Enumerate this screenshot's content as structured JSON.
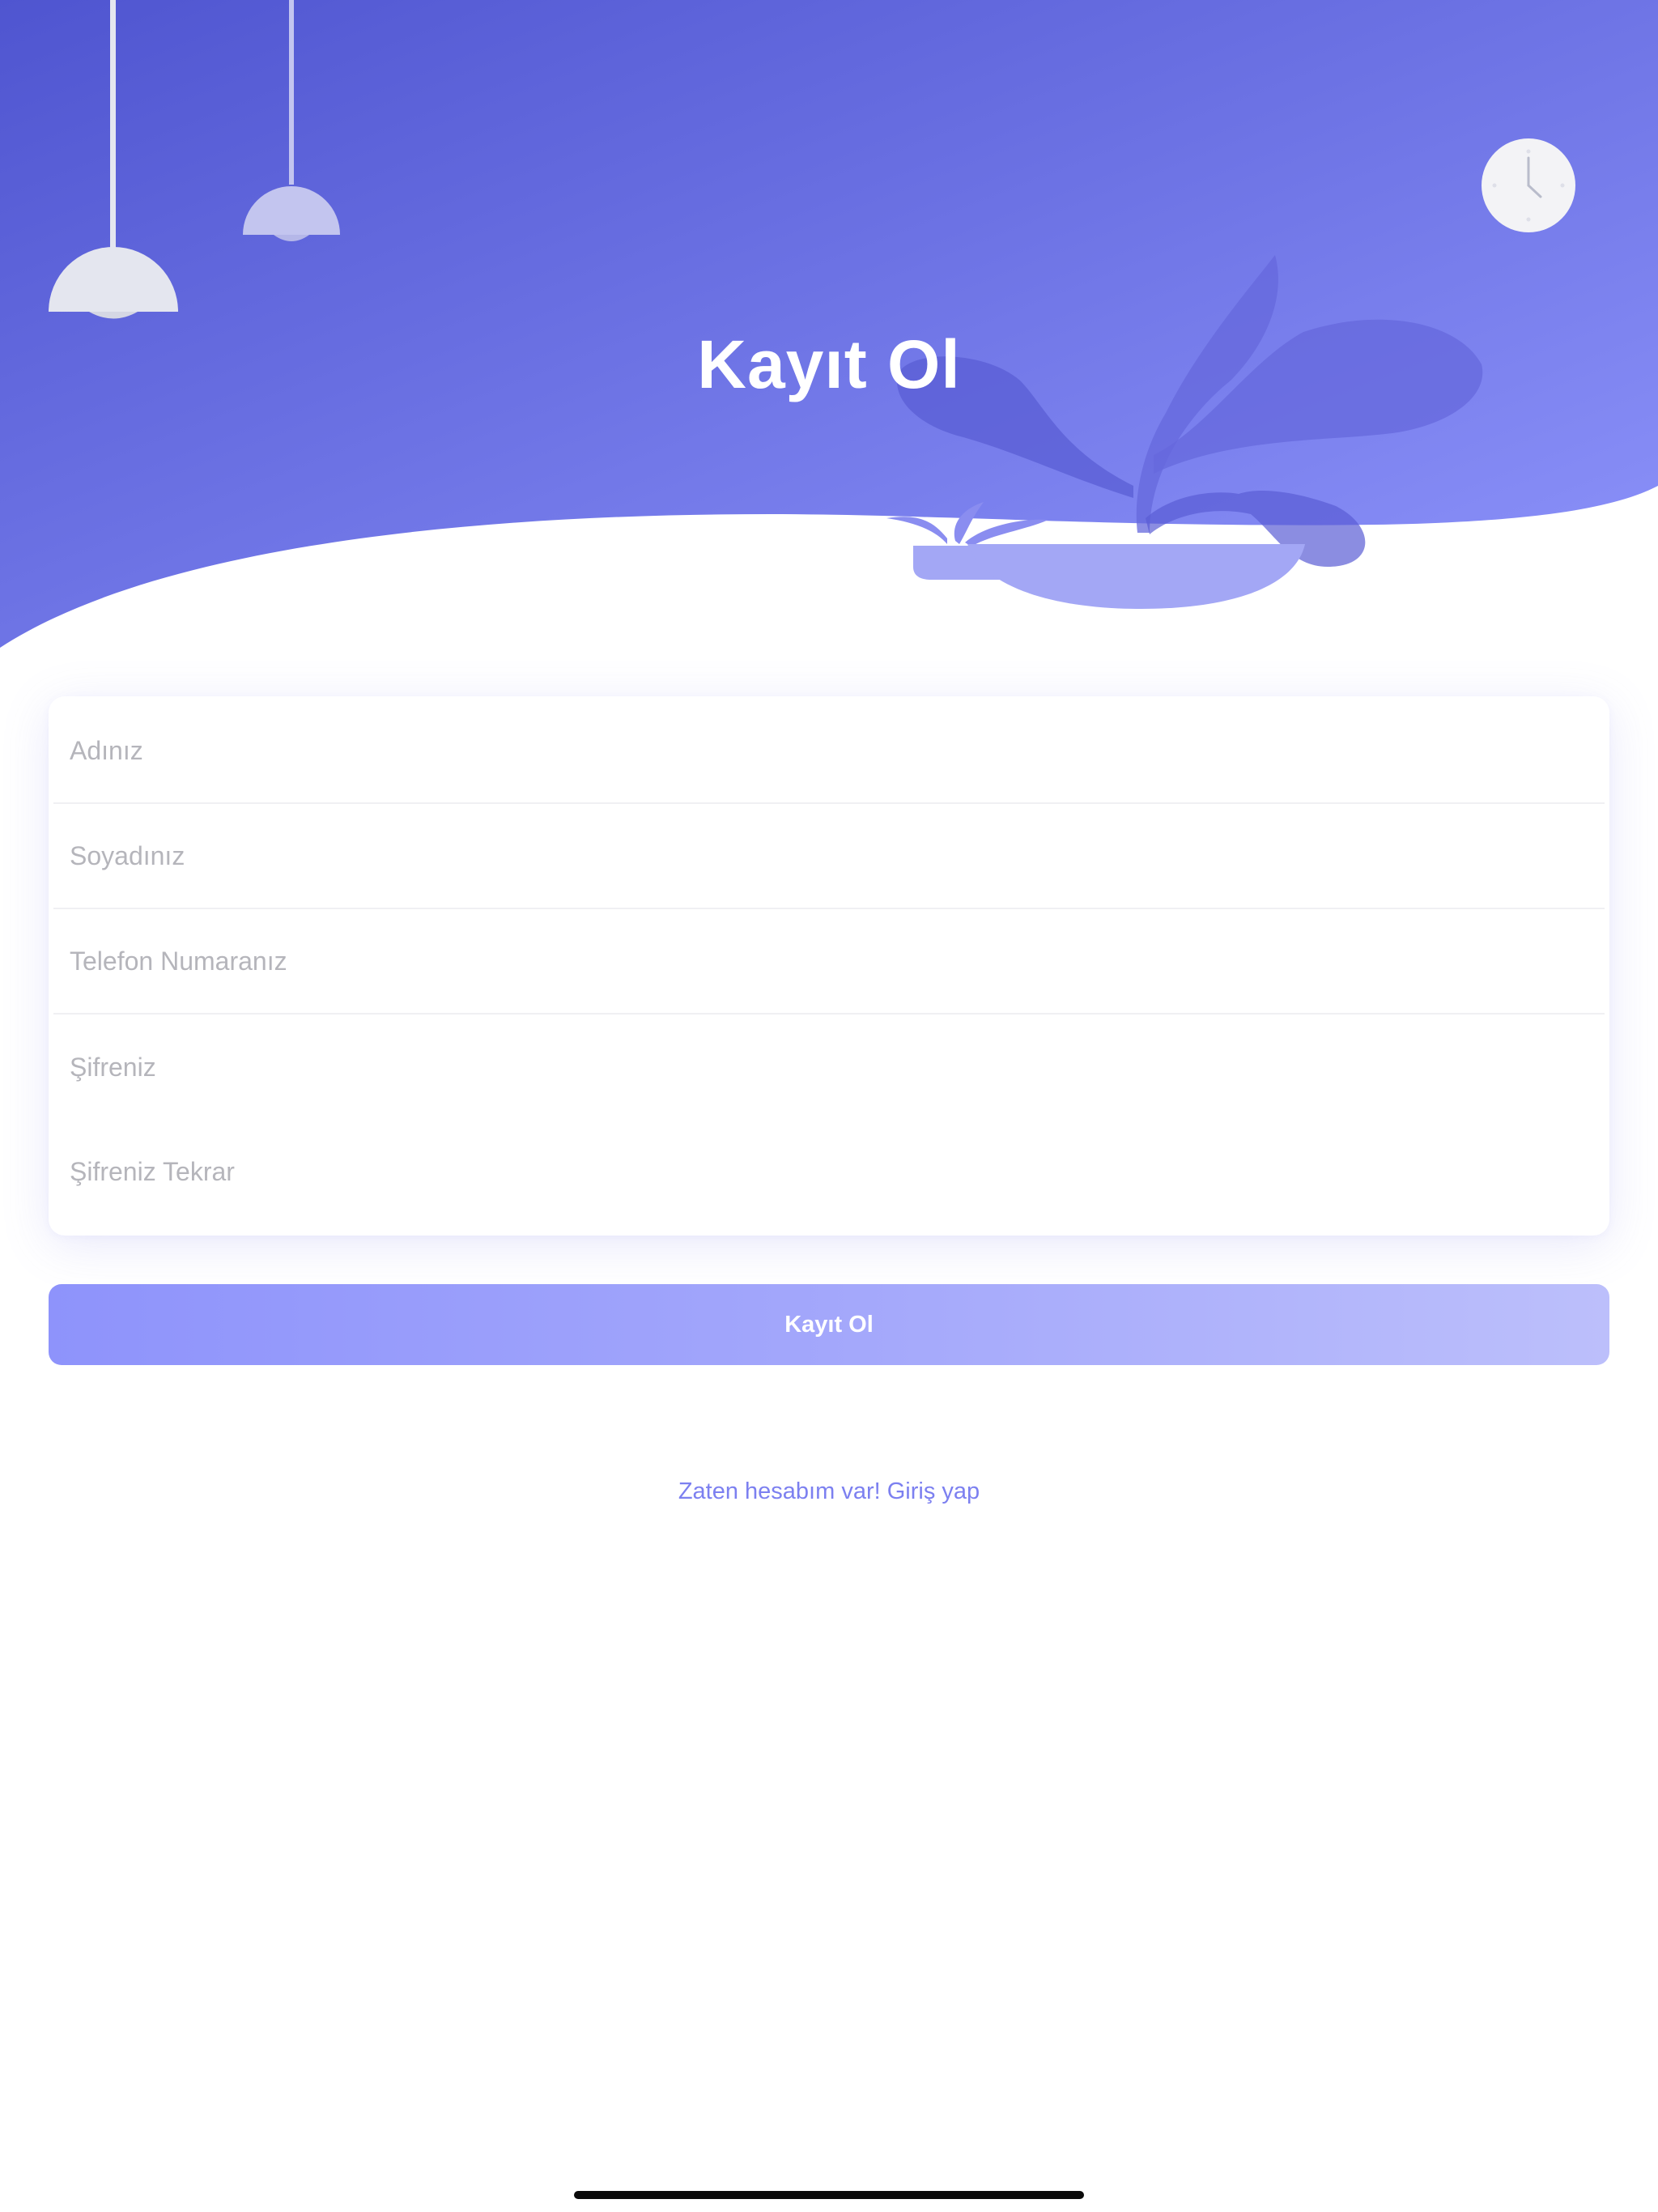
{
  "header": {
    "title": "Kayıt Ol"
  },
  "form": {
    "fields": [
      {
        "placeholder": "Adınız",
        "value": ""
      },
      {
        "placeholder": "Soyadınız",
        "value": ""
      },
      {
        "placeholder": "Telefon Numaranız",
        "value": ""
      },
      {
        "placeholder": "Şifreniz",
        "value": ""
      },
      {
        "placeholder": "Şifreniz Tekrar",
        "value": ""
      }
    ]
  },
  "actions": {
    "submit_label": "Kayıt Ol",
    "login_link_label": "Zaten hesabım var! Giriş yap"
  },
  "illustration": {
    "icons": [
      "pendant-lamp-icon",
      "pendant-lamp-icon",
      "wall-clock-icon",
      "potted-plant-icon"
    ]
  },
  "colors": {
    "header_gradient_start": "#4f55d0",
    "header_gradient_end": "#8e94fb",
    "accent": "#7c80f0",
    "button_gradient_start": "#8e93fb",
    "button_gradient_end": "#bcbffb",
    "placeholder": "#b5b5bb"
  }
}
